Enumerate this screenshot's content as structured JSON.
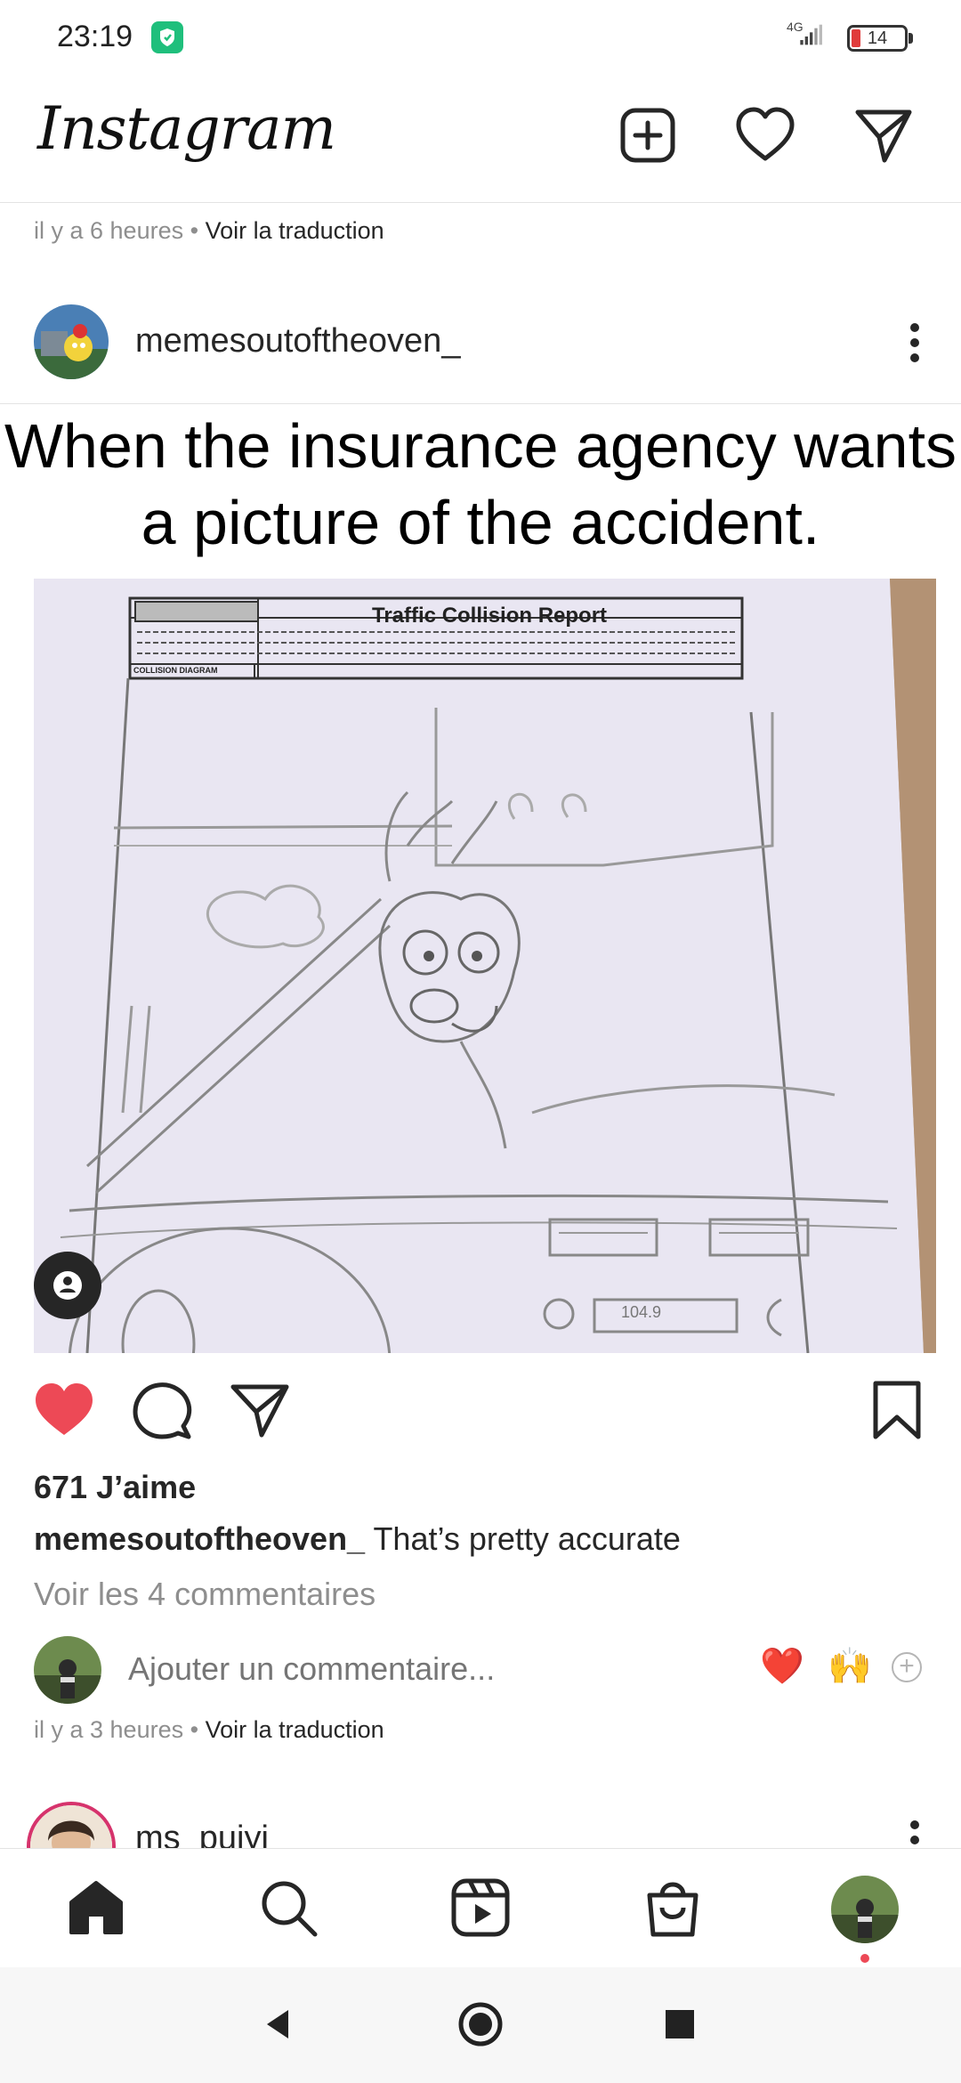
{
  "status_bar": {
    "time": "23:19",
    "network": "4G",
    "battery": "14"
  },
  "header": {
    "app_title": "Instagram"
  },
  "top_meta": {
    "time_ago": "il y a 6 heures",
    "separator": " • ",
    "translate": "Voir la traduction"
  },
  "post": {
    "username": "memesoutoftheoven_",
    "meme_caption": "When the insurance agency wants a picture of the accident.",
    "image_doc_title": "Traffic Collision Report",
    "image_doc_label": "COLLISION DIAGRAM",
    "image_radio_display": "104.9",
    "likes": "671 J’aime",
    "caption_username": "memesoutoftheoven_",
    "caption_text": "That’s pretty accurate",
    "view_comments": "Voir les 4 commentaires",
    "add_comment_placeholder": "Ajouter un commentaire...",
    "quick_emoji_1": "❤️",
    "quick_emoji_2": "🙌",
    "time_ago": "il y a 3 heures",
    "separator": " • ",
    "translate": "Voir la traduction",
    "liked": true
  },
  "next_post": {
    "username": "ms_puiyi"
  },
  "colors": {
    "like_red": "#ed4956",
    "shield_green": "#1fbf7c",
    "text_primary": "#262626",
    "text_secondary": "#8e8e8e"
  }
}
